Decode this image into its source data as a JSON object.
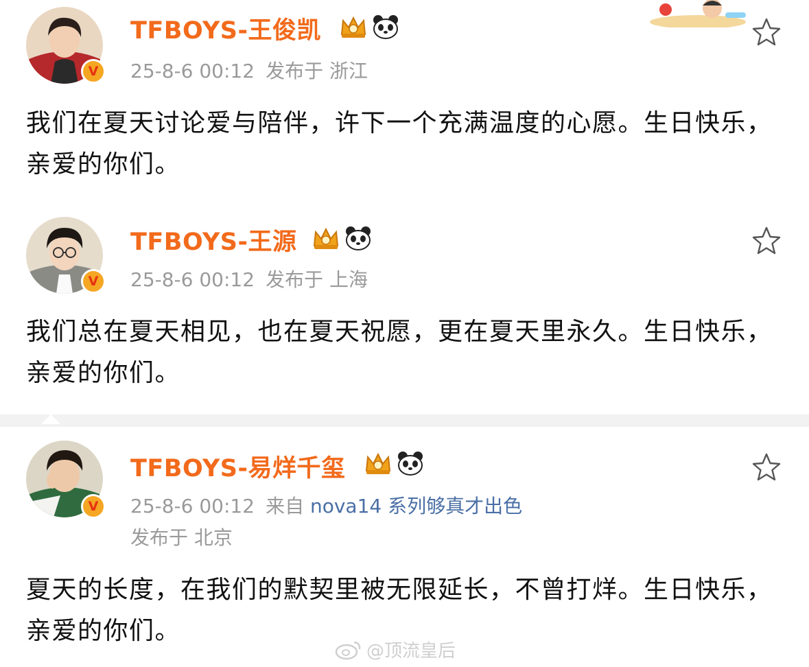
{
  "posts": [
    {
      "name": "TFBOYS-王俊凯",
      "time": "25-8-6 00:12",
      "location": "发布于 浙江",
      "text": "我们在夏天讨论爱与陪伴，许下一个充满温度的心愿。生日快乐，亲爱的你们。"
    },
    {
      "name": "TFBOYS-王源",
      "time": "25-8-6 00:12",
      "location": "发布于 上海",
      "text": "我们总在夏天相见，也在夏天祝愿，更在夏天里永久。生日快乐，亲爱的你们。"
    },
    {
      "name": "TFBOYS-易烊千玺",
      "time": "25-8-6 00:12",
      "source_prefix": "来自",
      "source": "nova14 系列够真才出色",
      "location": "发布于 北京",
      "text": "夏天的长度，在我们的默契里被无限延长，不曾打烊。生日快乐，亲爱的你们。"
    }
  ],
  "watermark": "@顶流皇后",
  "icons": {
    "verified": "verified-v-badge",
    "crown": "crown-badge",
    "panda": "panda-badge",
    "star": "star-outline-icon"
  },
  "colors": {
    "name": "#f26a1b",
    "meta": "#9a9a9a",
    "source_link": "#4a6fa5",
    "verified": "#f5a623"
  }
}
